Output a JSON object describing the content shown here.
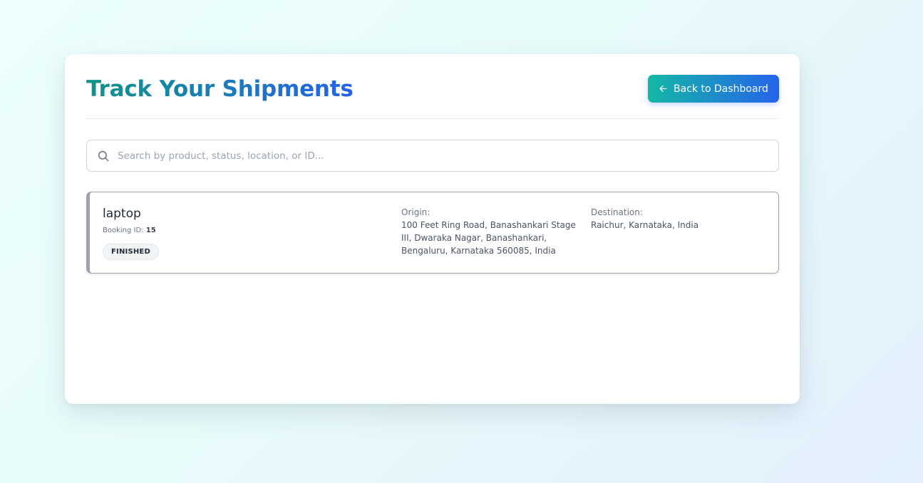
{
  "page": {
    "title": "Track Your Shipments",
    "back_button_label": "Back to Dashboard"
  },
  "search": {
    "placeholder": "Search by product, status, location, or ID...",
    "value": ""
  },
  "shipments": [
    {
      "product": "laptop",
      "booking_id_label": "Booking ID:",
      "booking_id": "15",
      "status": "FINISHED",
      "origin_label": "Origin:",
      "origin": "100 Feet Ring Road, Banashankari Stage III, Dwaraka Nagar, Banashankari, Bengaluru, Karnataka 560085, India",
      "destination_label": "Destination:",
      "destination": "Raichur, Karnataka, India"
    }
  ],
  "icons": {
    "back": "arrow-left-icon",
    "search": "search-icon"
  },
  "colors": {
    "gradient_start": "#14b8a6",
    "gradient_end": "#2563eb",
    "status_finished_border": "#9ca3af"
  }
}
